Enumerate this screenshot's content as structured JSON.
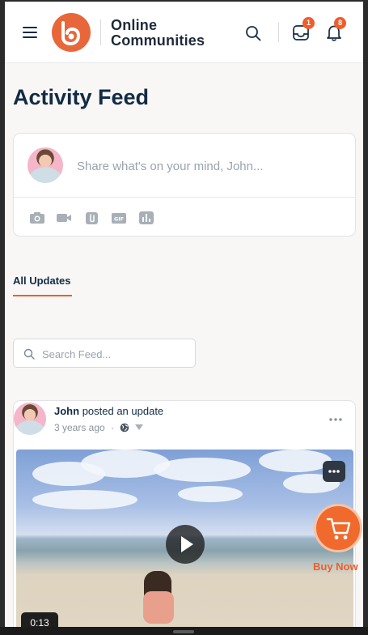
{
  "header": {
    "brand_line1": "Online",
    "brand_line2": "Communities",
    "messages_badge": "1",
    "notifications_badge": "8"
  },
  "page": {
    "title": "Activity Feed"
  },
  "composer": {
    "placeholder": "Share what's on your mind, John..."
  },
  "tabs": [
    {
      "label": "All Updates",
      "active": true
    }
  ],
  "feed_search": {
    "placeholder": "Search Feed..."
  },
  "post": {
    "author": "John",
    "action": "posted an update",
    "time": "3 years ago",
    "separator": "·",
    "duration": "0:13"
  },
  "buy_now": {
    "label": "Buy Now"
  },
  "colors": {
    "accent": "#ef5d2c",
    "text": "#122b46",
    "muted": "#9aa3ac"
  }
}
